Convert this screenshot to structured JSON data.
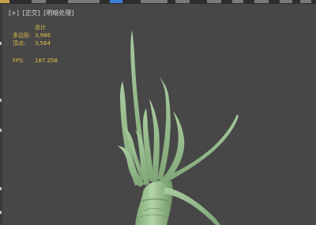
{
  "viewport": {
    "label_parts": [
      "[+]",
      "[正交]",
      "[明暗处理]"
    ]
  },
  "stats": {
    "header": "总计",
    "polygons_label": "多边形:",
    "polygons_value": "3,986",
    "vertices_label": "顶点:",
    "vertices_value": "3,564",
    "fps_label": "FPS:",
    "fps_value": "187.258"
  },
  "colors": {
    "viewport_bg": "#474747",
    "stats_text": "#e2c14a",
    "model_fill": "#a9cc9f",
    "model_shade": "#6f9465"
  },
  "icons": [
    "viewport-menu-icon"
  ]
}
